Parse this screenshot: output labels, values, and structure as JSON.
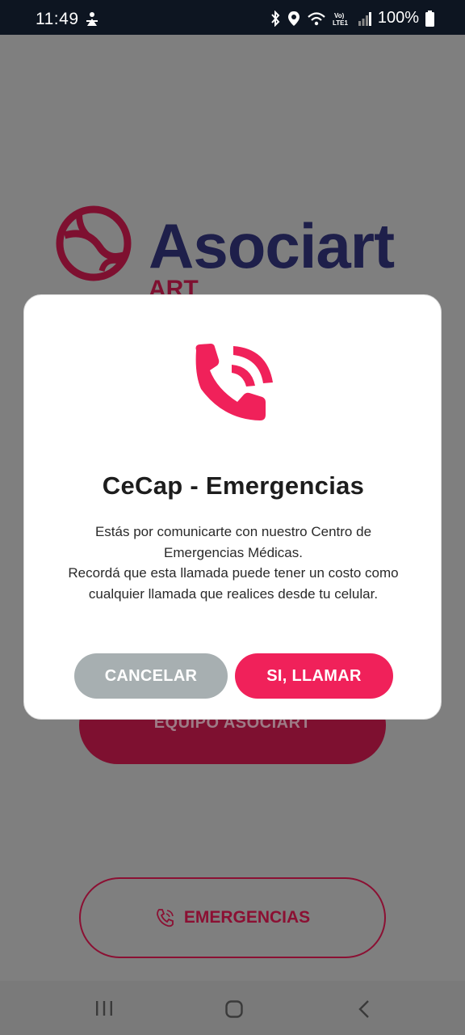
{
  "status_bar": {
    "time": "11:49",
    "battery": "100%",
    "icons": [
      "bluetooth-icon",
      "location-icon",
      "wifi-icon",
      "volte-icon",
      "signal-icon",
      "battery-icon"
    ]
  },
  "background": {
    "logo": {
      "name": "Asociart",
      "sub": "ART"
    },
    "team_button": "EQUIPO ASOCIART",
    "emergency_button": "EMERGENCIAS"
  },
  "dialog": {
    "icon": "phone-calling-icon",
    "title": "CeCap - Emergencias",
    "body_line1": "Estás por comunicarte con nuestro Centro de",
    "body_line2": "Emergencias Médicas.",
    "body_line3": "Recordá que esta llamada puede tener un costo como",
    "body_line4": "cualquier llamada que realices desde tu celular.",
    "cancel_label": "CANCELAR",
    "confirm_label": "SI, LLAMAR"
  },
  "colors": {
    "accent": "#f0215a",
    "cancel": "#a7afb1",
    "brand_dark": "#1e1f4a",
    "brand_red": "#7e1030"
  }
}
